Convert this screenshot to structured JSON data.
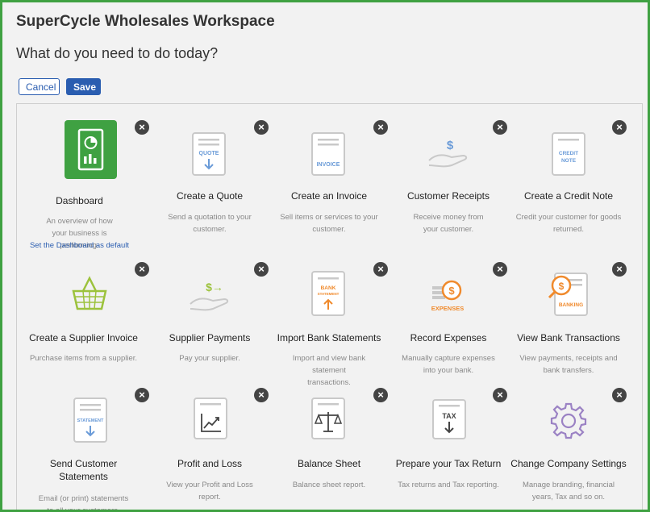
{
  "header": {
    "title": "SuperCycle Wholesales Workspace",
    "subtitle": "What do you need to do today?"
  },
  "actions": {
    "cancel_label": "Cancel",
    "save_label": "Save"
  },
  "close_symbol": "×",
  "tiles": [
    {
      "name": "Dashboard",
      "desc": "An overview of how your business is performing.",
      "link": "Set the Dashboard as default",
      "icon": "dashboard-icon"
    },
    {
      "name": "Create a Quote",
      "desc": "Send a quotation to your customer.",
      "icon": "quote-icon",
      "icon_text": "QUOTE"
    },
    {
      "name": "Create an Invoice",
      "desc": "Sell items or services to your customer.",
      "icon": "invoice-icon",
      "icon_text": "INVOICE"
    },
    {
      "name": "Customer Receipts",
      "desc": "Receive money from your customer.",
      "icon": "receipt-hand-icon",
      "icon_text": "$"
    },
    {
      "name": "Create a Credit Note",
      "desc": "Credit your customer for goods returned.",
      "icon": "credit-note-icon",
      "icon_text": "CREDIT NOTE"
    },
    {
      "name": "Create a Supplier Invoice",
      "desc": "Purchase items from a supplier.",
      "icon": "basket-icon"
    },
    {
      "name": "Supplier Payments",
      "desc": "Pay your supplier.",
      "icon": "payment-hand-icon",
      "icon_text": "$→"
    },
    {
      "name": "Import Bank Statements",
      "desc": "Import and view bank statement transactions.",
      "icon": "bank-statement-icon",
      "icon_text": "BANK STATEMENT"
    },
    {
      "name": "Record Expenses",
      "desc": "Manually capture expenses into your bank.",
      "icon": "expenses-icon",
      "icon_text": "EXPENSES"
    },
    {
      "name": "View Bank Transactions",
      "desc": "View payments, receipts and bank transfers.",
      "icon": "banking-icon",
      "icon_text": "BANKING"
    },
    {
      "name": "Send Customer Statements",
      "desc": "Email (or print) statements to all your customers.",
      "icon": "statement-icon",
      "icon_text": "STATEMENT"
    },
    {
      "name": "Profit and Loss",
      "desc": "View your Profit and Loss report.",
      "icon": "profit-loss-icon"
    },
    {
      "name": "Balance Sheet",
      "desc": "Balance sheet report.",
      "icon": "balance-scale-icon"
    },
    {
      "name": "Prepare your Tax Return",
      "desc": "Tax returns and Tax reporting.",
      "icon": "tax-icon",
      "icon_text": "TAX"
    },
    {
      "name": "Change Company Settings",
      "desc": "Manage branding, financial years, Tax and so on.",
      "icon": "gear-icon"
    }
  ],
  "colors": {
    "brand_green": "#3fa142",
    "accent_blue": "#2a5db0",
    "icon_blue": "#6a9bd8",
    "icon_orange": "#f08a2c",
    "icon_lime": "#9cc23c",
    "icon_purple": "#9b82c4"
  }
}
